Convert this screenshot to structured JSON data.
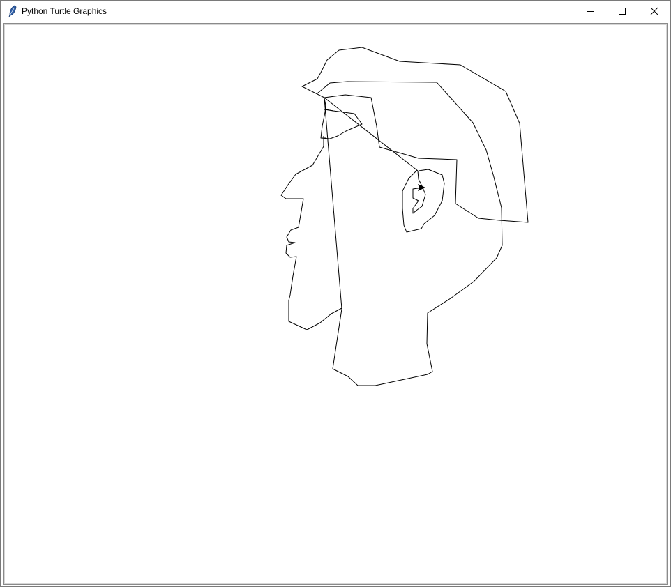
{
  "window": {
    "title": "Python Turtle Graphics",
    "icon": "feather-icon",
    "controls": [
      "minimize-icon",
      "maximize-icon",
      "close-icon"
    ]
  },
  "canvas": {
    "background": "#ffffff",
    "pen_color": "#000000",
    "turtle_cursor": "arrow-icon"
  }
}
